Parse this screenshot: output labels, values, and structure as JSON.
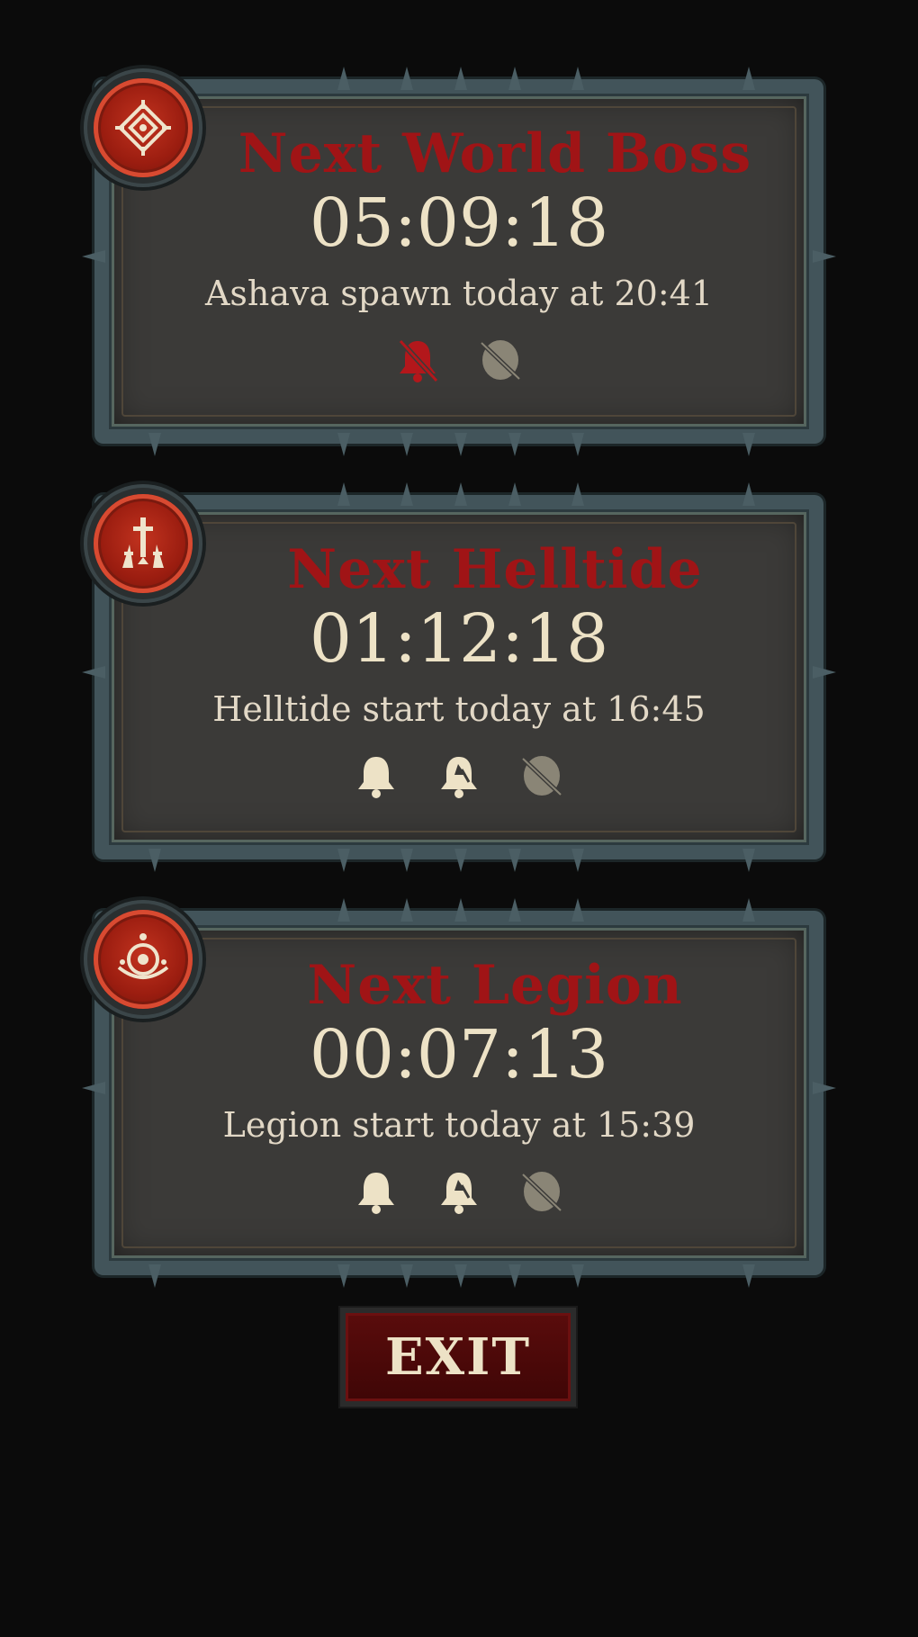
{
  "cards": [
    {
      "title": "Next World Boss",
      "timer": "05:09:18",
      "subtitle": "Ashava spawn today at 20:41",
      "badge_icon": "world-boss-rune-icon",
      "icons": [
        "bell-muted-icon",
        "shield-off-icon"
      ]
    },
    {
      "title": "Next Helltide",
      "timer": "01:12:18",
      "subtitle": "Helltide start today at 16:45",
      "badge_icon": "helltide-swords-icon",
      "icons": [
        "bell-icon",
        "bell-ring-icon",
        "shield-off-icon"
      ]
    },
    {
      "title": "Next Legion",
      "timer": "00:07:13",
      "subtitle": "Legion start today at 15:39",
      "badge_icon": "legion-sigil-icon",
      "icons": [
        "bell-icon",
        "bell-ring-icon",
        "shield-off-icon"
      ]
    }
  ],
  "exit_label": "EXIT",
  "colors": {
    "background": "#0b0b0b",
    "title_red": "#a01416",
    "text_cream": "#ede2c6",
    "frame_steel": "#42545a",
    "icon_muted_red": "#b3171b",
    "icon_disabled": "#8a8576"
  }
}
